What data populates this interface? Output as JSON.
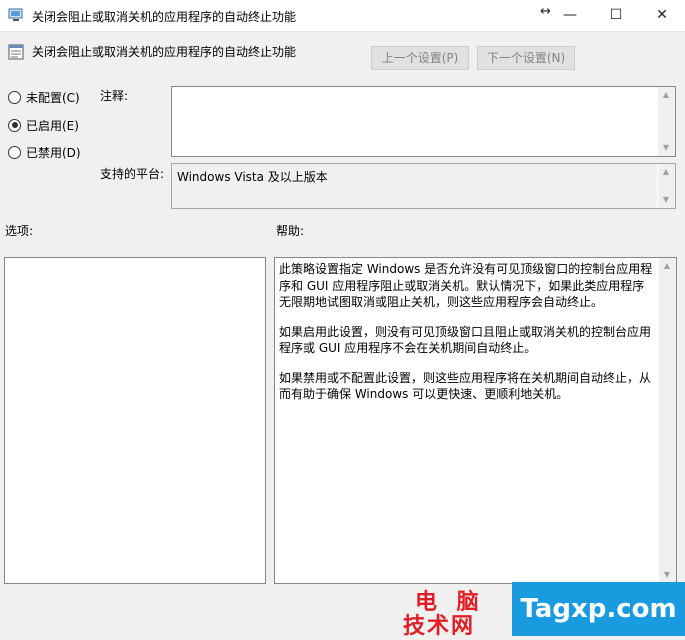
{
  "window": {
    "title": "关闭会阻止或取消关机的应用程序的自动终止功能",
    "minimize_glyph": "—",
    "maximize_glyph": "☐",
    "close_glyph": "✕",
    "resize_glyph": "↔"
  },
  "header": {
    "title": "关闭会阻止或取消关机的应用程序的自动终止功能",
    "prev_button": "上一个设置(P)",
    "next_button": "下一个设置(N)"
  },
  "options": {
    "not_configured": "未配置(C)",
    "enabled": "已启用(E)",
    "disabled": "已禁用(D)",
    "selected": "enabled"
  },
  "labels": {
    "comment": "注释:",
    "supported_on": "支持的平台:",
    "options": "选项:",
    "help": "帮助:"
  },
  "comment": {
    "value": ""
  },
  "supported_on": {
    "value": "Windows Vista 及以上版本"
  },
  "help": {
    "p1": "此策略设置指定 Windows 是否允许没有可见顶级窗口的控制台应用程序和 GUI 应用程序阻止或取消关机。默认情况下，如果此类应用程序无限期地试图取消或阻止关机，则这些应用程序会自动终止。",
    "p2": "如果启用此设置，则没有可见顶级窗口且阻止或取消关机的控制台应用程序或 GUI 应用程序不会在关机期间自动终止。",
    "p3": "如果禁用或不配置此设置，则这些应用程序将在关机期间自动终止，从而有助于确保 Windows 可以更快速、更顺利地关机。"
  },
  "watermark": {
    "line1": "电 脑",
    "line2": "技术网",
    "site": "Tagxp.com"
  },
  "colors": {
    "watermark_red": "#e01e26",
    "watermark_blue": "#1a9be0"
  }
}
